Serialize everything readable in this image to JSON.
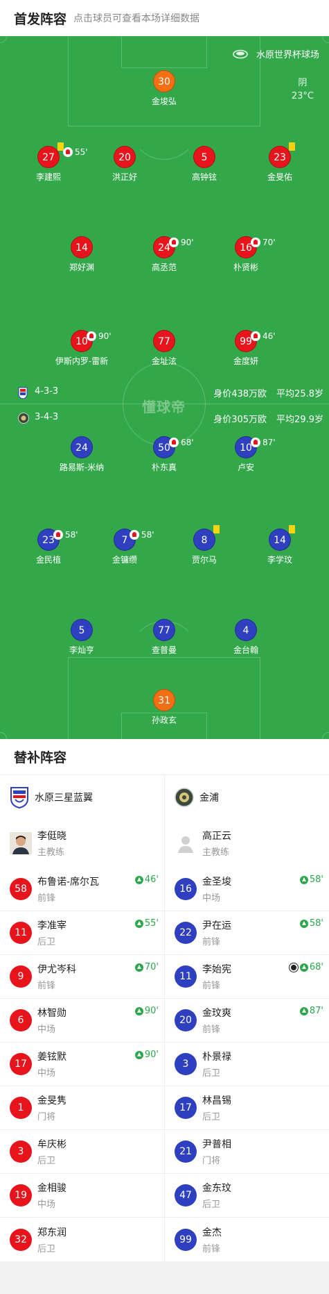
{
  "header": {
    "title": "首发阵容",
    "subtitle": "点击球员可查看本场详细数据"
  },
  "pitch": {
    "venue": "水原世界杯球场",
    "weather": "阴",
    "temperature": "23°C",
    "watermark": "懂球帝",
    "home": {
      "formation": "4-3-3",
      "value": "身价438万欧",
      "avg_age": "平均25.8岁",
      "color": "#e8141c",
      "goalkeeper": {
        "number": "30",
        "name": "金埈弘"
      },
      "defenders": [
        {
          "number": "27",
          "name": "李建熙",
          "yellow": true,
          "sub_out": "55'"
        },
        {
          "number": "20",
          "name": "洪正好"
        },
        {
          "number": "5",
          "name": "高钟铉"
        },
        {
          "number": "23",
          "name": "金旻佑",
          "yellow": true
        }
      ],
      "midfielders": [
        {
          "number": "14",
          "name": "郑好渊"
        },
        {
          "number": "24",
          "name": "高丞范",
          "sub_out": "90'"
        },
        {
          "number": "16",
          "name": "朴贤彬",
          "sub_out": "70'"
        }
      ],
      "forwards": [
        {
          "number": "10",
          "name": "伊斯内罗-雷新",
          "sub_out": "90'"
        },
        {
          "number": "77",
          "name": "金址泫"
        },
        {
          "number": "99",
          "name": "金度妍",
          "sub_out": "46'"
        }
      ]
    },
    "away": {
      "formation": "3-4-3",
      "value": "身价305万欧",
      "avg_age": "平均29.9岁",
      "color": "#2e3fbf",
      "forwards": [
        {
          "number": "24",
          "name": "路易斯-米纳"
        },
        {
          "number": "50",
          "name": "朴东真",
          "sub_out": "68'"
        },
        {
          "number": "10",
          "name": "卢安",
          "sub_out": "87'"
        }
      ],
      "midfielders": [
        {
          "number": "23",
          "name": "金民植",
          "sub_out": "58'"
        },
        {
          "number": "7",
          "name": "金镛缵",
          "sub_out": "58'"
        },
        {
          "number": "8",
          "name": "贾尔马",
          "yellow": true
        },
        {
          "number": "14",
          "name": "李学玟",
          "yellow": true
        }
      ],
      "defenders": [
        {
          "number": "5",
          "name": "李灿亨"
        },
        {
          "number": "77",
          "name": "查普曼"
        },
        {
          "number": "4",
          "name": "金台翰"
        }
      ],
      "goalkeeper": {
        "number": "31",
        "name": "孙政玄"
      }
    }
  },
  "subs": {
    "title": "替补阵容",
    "home": {
      "team": "水原三星蓝翼",
      "coach": {
        "name": "李侹晓",
        "role": "主教练"
      },
      "players": [
        {
          "number": "58",
          "name": "布鲁诺-席尔瓦",
          "pos": "前锋",
          "in": "46'"
        },
        {
          "number": "11",
          "name": "李准宰",
          "pos": "后卫",
          "in": "55'"
        },
        {
          "number": "9",
          "name": "伊尤岑科",
          "pos": "前锋",
          "in": "70'"
        },
        {
          "number": "6",
          "name": "林智勋",
          "pos": "中场",
          "in": "90'"
        },
        {
          "number": "17",
          "name": "姜铉默",
          "pos": "中场",
          "in": "90'"
        },
        {
          "number": "1",
          "name": "金旻隽",
          "pos": "门将"
        },
        {
          "number": "3",
          "name": "牟庆彬",
          "pos": "后卫"
        },
        {
          "number": "19",
          "name": "金相骏",
          "pos": "中场"
        },
        {
          "number": "32",
          "name": "郑东润",
          "pos": "后卫"
        }
      ]
    },
    "away": {
      "team": "金浦",
      "coach": {
        "name": "高正云",
        "role": "主教练"
      },
      "players": [
        {
          "number": "16",
          "name": "金圣埈",
          "pos": "中场",
          "in": "58'"
        },
        {
          "number": "22",
          "name": "尹在运",
          "pos": "前锋",
          "in": "58'"
        },
        {
          "number": "11",
          "name": "李始宪",
          "pos": "前锋",
          "in": "68'",
          "goal": true
        },
        {
          "number": "20",
          "name": "金玟爽",
          "pos": "前锋",
          "in": "87'"
        },
        {
          "number": "3",
          "name": "朴景禄",
          "pos": "后卫"
        },
        {
          "number": "17",
          "name": "林昌锡",
          "pos": "后卫"
        },
        {
          "number": "21",
          "name": "尹普相",
          "pos": "门将"
        },
        {
          "number": "47",
          "name": "金东玟",
          "pos": "后卫"
        },
        {
          "number": "99",
          "name": "金杰",
          "pos": "前锋"
        }
      ]
    }
  }
}
